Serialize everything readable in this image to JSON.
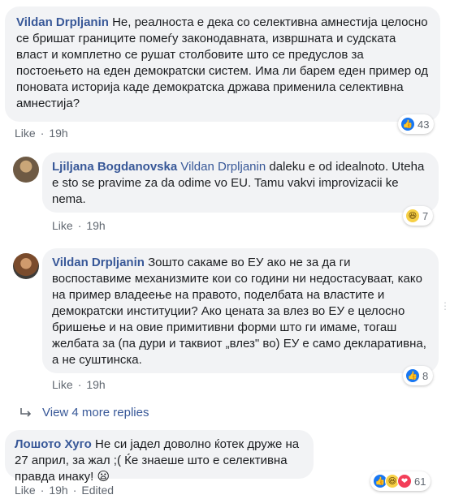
{
  "comments": [
    {
      "author": "Vildan Drpljanin",
      "text": "Не, реалноста е дека со селективна амнестија целосно се бришат границите помеѓу законодавната, извршната и судската власт и комплетно се рушат столбовите што се предуслов за постоењето на еден демократски систем. Има ли барем еден пример од поновата историја каде демократска држава применила селективна амнестија?",
      "like_label": "Like",
      "time": "19h",
      "reactions": {
        "icons": [
          "like"
        ],
        "count": "43"
      }
    },
    {
      "author": "Ljiljana Bogdanovska",
      "mention": "Vildan Drpljanin",
      "text": " daleku e od idealnoto. Uteha e sto se pravime za da odime vo EU. Tamu vakvi improvizacii ke nema.",
      "like_label": "Like",
      "time": "19h",
      "reactions": {
        "icons": [
          "haha"
        ],
        "count": "7"
      }
    },
    {
      "author": "Vildan Drpljanin",
      "text": " Зошто сакаме во ЕУ ако не за да ги воспоставиме механизмите кои со години ни недостасуваат, како на пример владеење на правото, поделбата на властите и демократски институции? Ако цената за влез во ЕУ е целосно бришење и на овие примитивни форми што ги имаме, тогаш желбата за (па дури и таквиот „влез\" во) ЕУ е само декларативна, а не суштинска.",
      "like_label": "Like",
      "time": "19h",
      "reactions": {
        "icons": [
          "like"
        ],
        "count": "8"
      }
    },
    {
      "author": "Лошото Хуго",
      "text": " Не си јадел доволно ќотек друже на 27 април, за жал ;( Ќе знаеше што е селективна правда инаку! ",
      "emoji": "😦",
      "like_label": "Like",
      "time": "19h",
      "edited_label": "Edited",
      "reactions": {
        "icons": [
          "like",
          "haha",
          "love"
        ],
        "count": "61"
      }
    }
  ],
  "view_more": "View 4 more replies",
  "colors": {
    "link": "#385898",
    "bubble": "#f2f3f5",
    "meta": "#606770",
    "like": "#1877f2"
  }
}
